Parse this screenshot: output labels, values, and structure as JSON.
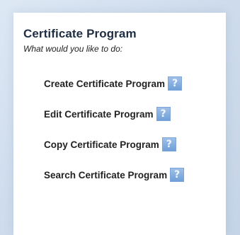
{
  "header": {
    "title": "Certificate Program",
    "subtitle": "What would you like to do:"
  },
  "menu": {
    "items": [
      {
        "label": "Create Certificate Program",
        "help_glyph": "?"
      },
      {
        "label": "Edit Certificate Program",
        "help_glyph": "?"
      },
      {
        "label": "Copy Certificate Program",
        "help_glyph": "?"
      },
      {
        "label": "Search Certificate Program",
        "help_glyph": "?"
      }
    ]
  },
  "colors": {
    "help_icon": "#7aa6dc",
    "panel": "#ffffff",
    "background": "#d2dfee"
  }
}
